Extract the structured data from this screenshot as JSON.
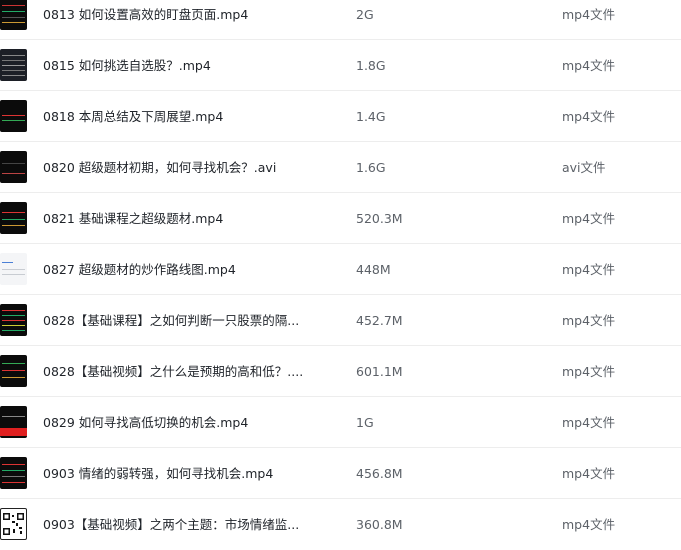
{
  "files": [
    {
      "name": "0813 如何设置高效的盯盘页面.mp4",
      "size": "2G",
      "type": "mp4文件",
      "thumb_icon": "video-thumbnail"
    },
    {
      "name": "0815 如何挑选自选股？.mp4",
      "size": "1.8G",
      "type": "mp4文件",
      "thumb_icon": "video-thumbnail"
    },
    {
      "name": "0818 本周总结及下周展望.mp4",
      "size": "1.4G",
      "type": "mp4文件",
      "thumb_icon": "video-thumbnail"
    },
    {
      "name": "0820 超级题材初期，如何寻找机会？.avi",
      "size": "1.6G",
      "type": "avi文件",
      "thumb_icon": "video-thumbnail"
    },
    {
      "name": "0821 基础课程之超级题材.mp4",
      "size": "520.3M",
      "type": "mp4文件",
      "thumb_icon": "video-thumbnail"
    },
    {
      "name": "0827 超级题材的炒作路线图.mp4",
      "size": "448M",
      "type": "mp4文件",
      "thumb_icon": "video-thumbnail"
    },
    {
      "name": "0828【基础课程】之如何判断一只股票的隔...",
      "size": "452.7M",
      "type": "mp4文件",
      "thumb_icon": "video-thumbnail"
    },
    {
      "name": "0828【基础视频】之什么是预期的高和低？....",
      "size": "601.1M",
      "type": "mp4文件",
      "thumb_icon": "video-thumbnail"
    },
    {
      "name": "0829 如何寻找高低切换的机会.mp4",
      "size": "1G",
      "type": "mp4文件",
      "thumb_icon": "video-thumbnail"
    },
    {
      "name": "0903 情绪的弱转强，如何寻找机会.mp4",
      "size": "456.8M",
      "type": "mp4文件",
      "thumb_icon": "video-thumbnail"
    },
    {
      "name": "0903【基础视频】之两个主题：市场情绪监...",
      "size": "360.8M",
      "type": "mp4文件",
      "thumb_icon": "qr-code-thumbnail"
    }
  ],
  "colors": {
    "text_primary": "#1f2329",
    "text_secondary": "#5c6168",
    "divider": "#ededed"
  }
}
